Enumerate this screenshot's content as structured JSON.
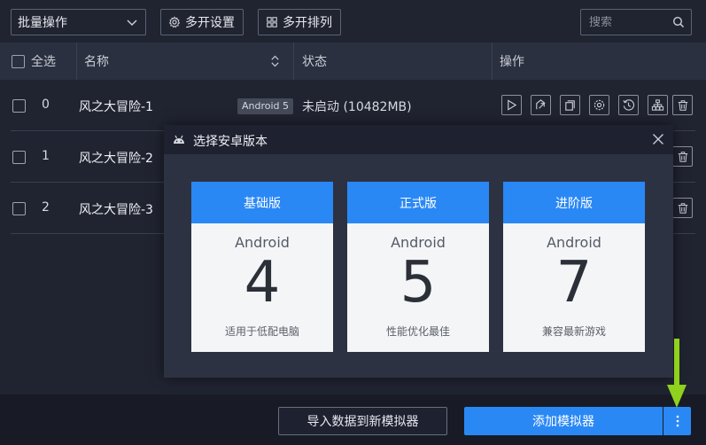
{
  "toolbar": {
    "batch_label": "批量操作",
    "multi_settings_label": "多开设置",
    "multi_arrange_label": "多开排列",
    "search_placeholder": "搜索"
  },
  "table": {
    "headers": {
      "select_all": "全选",
      "name": "名称",
      "status": "状态",
      "actions": "操作"
    },
    "rows": [
      {
        "index": "0",
        "name": "风之大冒险-1",
        "version": "Android 5",
        "status": "未启动 (10482MB)"
      },
      {
        "index": "1",
        "name": "风之大冒险-2"
      },
      {
        "index": "2",
        "name": "风之大冒险-3"
      }
    ]
  },
  "dialog": {
    "title": "选择安卓版本",
    "cards": [
      {
        "header": "基础版",
        "os": "Android",
        "version": "4",
        "desc": "适用于低配电脑"
      },
      {
        "header": "正式版",
        "os": "Android",
        "version": "5",
        "desc": "性能优化最佳"
      },
      {
        "header": "进阶版",
        "os": "Android",
        "version": "7",
        "desc": "兼容最新游戏"
      }
    ]
  },
  "footer": {
    "import_label": "导入数据到新模拟器",
    "add_label": "添加模拟器"
  },
  "colors": {
    "accent": "#2a88f5",
    "background": "#202431",
    "arrow": "#8fd11c"
  }
}
